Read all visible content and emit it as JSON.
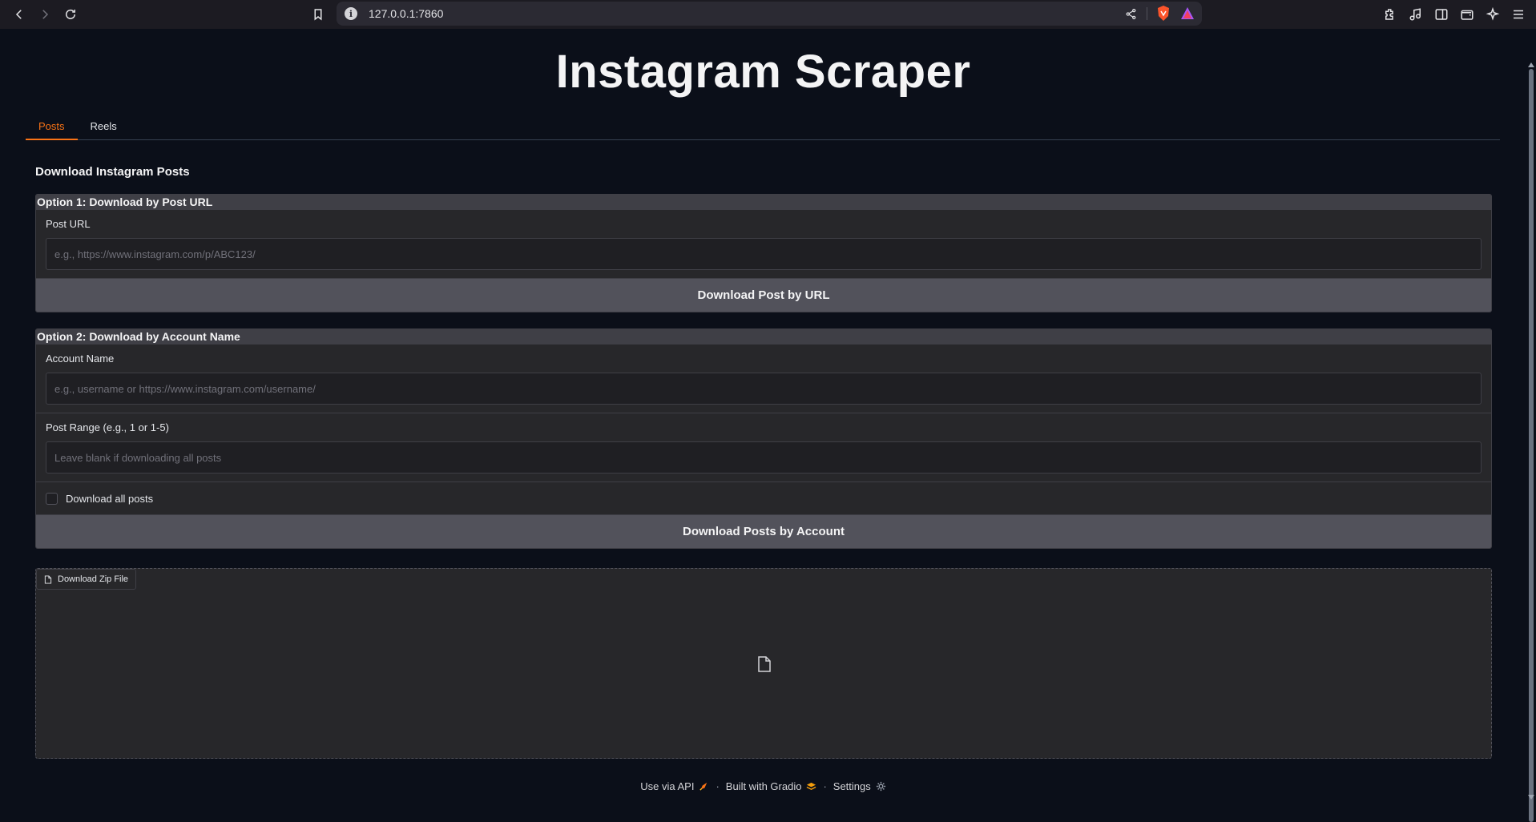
{
  "browser": {
    "url": "127.0.0.1:7860"
  },
  "page": {
    "title": "Instagram Scraper",
    "tabs": [
      {
        "label": "Posts",
        "active": true
      },
      {
        "label": "Reels",
        "active": false
      }
    ],
    "section_heading": "Download Instagram Posts",
    "option1": {
      "title": "Option 1: Download by Post URL",
      "field_label": "Post URL",
      "placeholder": "e.g., https://www.instagram.com/p/ABC123/",
      "button": "Download Post by URL"
    },
    "option2": {
      "title": "Option 2: Download by Account Name",
      "account_label": "Account Name",
      "account_placeholder": "e.g., username or https://www.instagram.com/username/",
      "range_label": "Post Range (e.g., 1 or 1-5)",
      "range_placeholder": "Leave blank if downloading all posts",
      "checkbox_label": "Download all posts",
      "button": "Download Posts by Account"
    },
    "file": {
      "label": "Download Zip File"
    },
    "footer": {
      "api": "Use via API",
      "built": "Built with Gradio",
      "settings": "Settings",
      "separator": "·"
    }
  },
  "colors": {
    "accent": "#f97316",
    "background": "#0b0f19",
    "panel": "#27272a"
  }
}
